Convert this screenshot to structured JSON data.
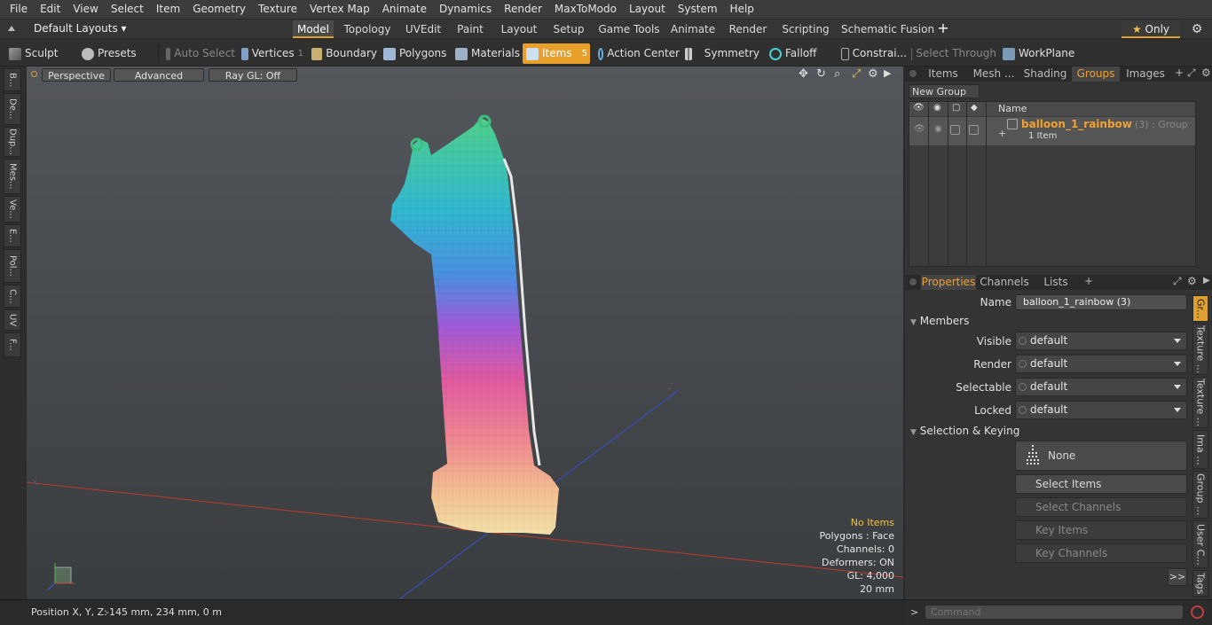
{
  "menu": [
    "File",
    "Edit",
    "View",
    "Select",
    "Item",
    "Geometry",
    "Texture",
    "Vertex Map",
    "Animate",
    "Dynamics",
    "Render",
    "MaxToModo",
    "Layout",
    "System",
    "Help"
  ],
  "layout_bar": {
    "layouts_label": "Default Layouts",
    "tabs": [
      "Model",
      "Topology",
      "UVEdit",
      "Paint",
      "Layout",
      "Setup",
      "Game Tools",
      "Animate",
      "Render",
      "Scripting",
      "Schematic Fusion"
    ],
    "active_tab": "Model",
    "add_tab": "+",
    "only_label": "Only"
  },
  "toolbar": {
    "sculpt": "Sculpt",
    "presets": "Presets",
    "auto_select": "Auto Select",
    "vertices": "Vertices",
    "vertices_count": "1",
    "boundary": "Boundary",
    "polygons": "Polygons",
    "materials": "Materials",
    "items": "Items",
    "items_count": "5",
    "action_center": "Action Center",
    "symmetry": "Symmetry",
    "falloff": "Falloff",
    "constraints": "Constrai...",
    "select_through": "Select Through",
    "workplane": "WorkPlane"
  },
  "left_tabs": [
    "B...",
    "De...",
    "Dup...",
    "Mes...",
    "Ve...",
    "E...",
    "Pol...",
    "C...",
    "UV",
    "F..."
  ],
  "viewport": {
    "view_label": "Perspective",
    "shading_label": "Advanced",
    "raygl_label": "Ray GL: Off",
    "info": {
      "items": "No Items",
      "polygons": "Polygons : Face",
      "channels": "Channels: 0",
      "deformers": "Deformers: ON",
      "gl": "GL: 4,000",
      "scale": "20 mm"
    },
    "axis_z_label": "Z",
    "axis_x_label": "X"
  },
  "status": {
    "position_label": "Position X, Y, Z:",
    "position_value": "-145 mm, 234 mm, 0 m"
  },
  "groups_panel": {
    "tabs": [
      "Items",
      "Mesh ...",
      "Shading",
      "Groups",
      "Images"
    ],
    "active_tab": "Groups",
    "new_group": "New Group",
    "name_header": "Name",
    "group_name": "balloon_1_rainbow",
    "group_suffix": "(3) : Group",
    "group_sub": "1 Item"
  },
  "properties_panel": {
    "tabs": [
      "Properties",
      "Channels",
      "Lists"
    ],
    "active_tab": "Properties",
    "name_label": "Name",
    "name_value": "balloon_1_rainbow (3)",
    "members_label": "Members",
    "rows": [
      {
        "label": "Visible",
        "value": "default"
      },
      {
        "label": "Render",
        "value": "default"
      },
      {
        "label": "Selectable",
        "value": "default"
      },
      {
        "label": "Locked",
        "value": "default"
      }
    ],
    "selection_label": "Selection & Keying",
    "none_label": "None",
    "select_items": "Select Items",
    "select_channels": "Select Channels",
    "key_items": "Key Items",
    "key_channels": "Key Channels",
    "more": ">>",
    "side_tabs": [
      "Gr...",
      "Texture ...",
      "Texture ...",
      "Ima ...",
      "Group ...",
      "User C...",
      "Tags"
    ]
  },
  "command": {
    "prompt": ">",
    "placeholder": "Command"
  },
  "colors": {
    "accent": "#e8a02a",
    "group_name": "#f0a030"
  }
}
